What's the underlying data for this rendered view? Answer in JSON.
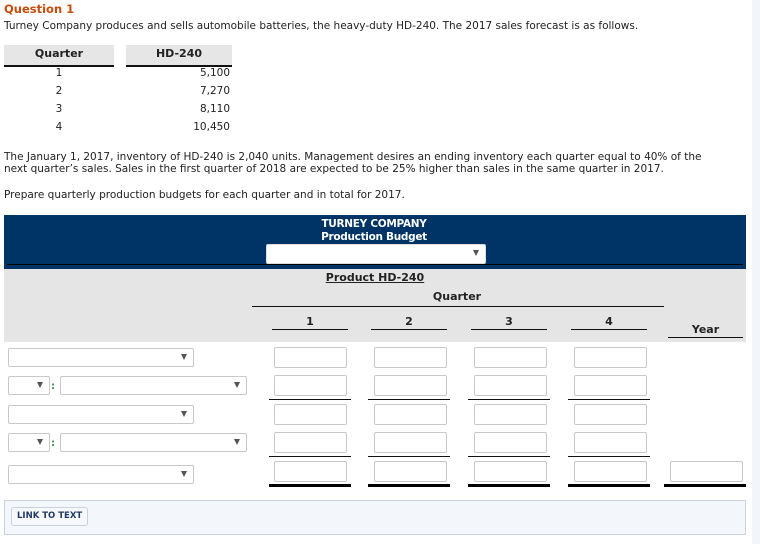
{
  "question": {
    "title": "Question 1",
    "intro": "Turney Company produces and sells automobile batteries, the heavy-duty HD-240. The 2017 sales forecast is as follows.",
    "forecast_table": {
      "headers": [
        "Quarter",
        "HD-240"
      ],
      "rows": [
        {
          "quarter": "1",
          "value": "5,100"
        },
        {
          "quarter": "2",
          "value": "7,270"
        },
        {
          "quarter": "3",
          "value": "8,110"
        },
        {
          "quarter": "4",
          "value": "10,450"
        }
      ]
    },
    "paragraph_line1": "The January 1, 2017, inventory of HD-240 is 2,040 units. Management desires an ending inventory each quarter equal to 40% of the",
    "paragraph_line2": "next quarter’s sales. Sales in the first quarter of 2018 are expected to be 25% higher than sales in the same quarter in 2017.",
    "instruction": "Prepare quarterly production budgets for each quarter and in total for 2017."
  },
  "budget": {
    "company": "TURNEY COMPANY",
    "title": "Production Budget",
    "period_select": {
      "value": ""
    },
    "product_label": "Product HD-240",
    "quarter_label": "Quarter",
    "quarter_headers": [
      "1",
      "2",
      "3",
      "4"
    ],
    "year_header": "Year",
    "colon": ":",
    "rows": [
      {
        "type": "select",
        "label": "",
        "values": [
          "",
          "",
          "",
          ""
        ]
      },
      {
        "type": "operator-select",
        "operator": "",
        "label": "",
        "values": [
          "",
          "",
          "",
          ""
        ]
      },
      {
        "type": "select",
        "label": "",
        "values": [
          "",
          "",
          "",
          ""
        ]
      },
      {
        "type": "operator-select",
        "operator": "",
        "label": "",
        "values": [
          "",
          "",
          "",
          ""
        ]
      },
      {
        "type": "select",
        "label": "",
        "values": [
          "",
          "",
          "",
          ""
        ],
        "year": ""
      }
    ]
  },
  "footer": {
    "link_to_text": "LINK TO TEXT"
  }
}
